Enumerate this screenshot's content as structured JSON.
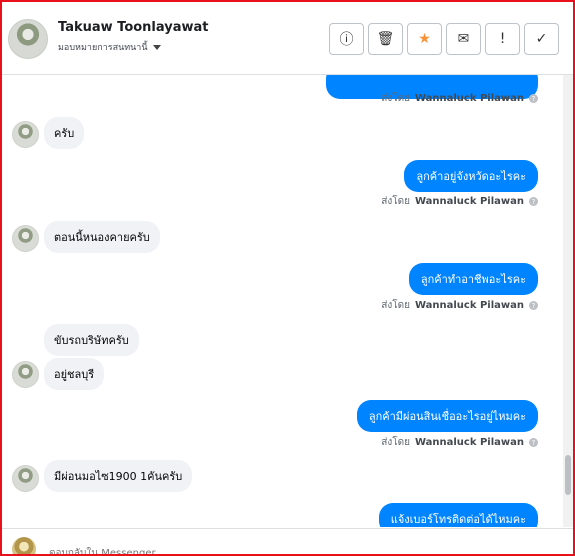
{
  "header": {
    "name": "Takuaw Toonlayawat",
    "assignment": "มอบหมายการสนทนานี้",
    "tools": [
      {
        "icon": "alert-circle-icon",
        "glyph": "ⓘ"
      },
      {
        "icon": "trash-icon",
        "glyph": "🗑"
      },
      {
        "icon": "star-icon",
        "glyph": "★"
      },
      {
        "icon": "envelope-icon",
        "glyph": "✉"
      },
      {
        "icon": "exclamation-icon",
        "glyph": "!"
      },
      {
        "icon": "check-icon",
        "glyph": "✓"
      }
    ],
    "colors": {
      "star": "#f7923a"
    }
  },
  "thread": {
    "sent_by_label": "ส่งโดย",
    "sender": "Wannaluck Pilawan",
    "help_glyph": "?",
    "messages": [
      {
        "dir": "out",
        "text": ""
      },
      {
        "dir": "in",
        "text": "ครับ"
      },
      {
        "dir": "out",
        "text": "ลูกค้าอยู่จังหวัดอะไรคะ"
      },
      {
        "dir": "in",
        "text": "ตอนนี้หนองคายครับ"
      },
      {
        "dir": "out",
        "text": "ลูกค้าทำอาชีพอะไรคะ"
      },
      {
        "dir": "in",
        "text": "ขับรถบริษัทครับ"
      },
      {
        "dir": "in",
        "text": "อยู่ชลบุรี"
      },
      {
        "dir": "out",
        "text": "ลูกค้ามีผ่อนสินเชื่ออะไรอยู่ไหมคะ"
      },
      {
        "dir": "in",
        "text": "มีผ่อนมอไซ1900 1คันครับ"
      },
      {
        "dir": "out",
        "text": "แจ้งเบอร์โทรติดต่อได้ไหมคะ"
      }
    ],
    "colors": {
      "outgoing": "#0084ff",
      "incoming": "#f0f2f5"
    }
  },
  "composer": {
    "placeholder": "ตอบกลับใน Messenger"
  }
}
